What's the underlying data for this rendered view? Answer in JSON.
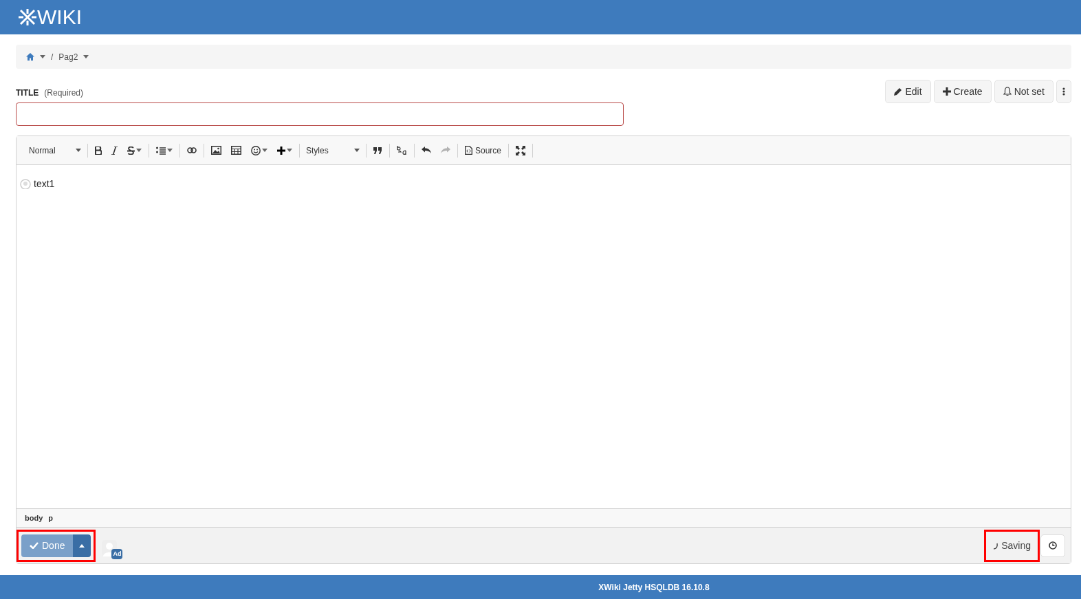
{
  "header": {
    "logo_text": "WIKI"
  },
  "breadcrumb": {
    "separator": "/",
    "items": [
      {
        "kind": "home"
      },
      {
        "kind": "page",
        "label": "Pag2"
      }
    ]
  },
  "title_field": {
    "label": "TITLE",
    "hint": "(Required)",
    "invalid": true
  },
  "page_actions": [
    {
      "kind": "edit",
      "label": "Edit"
    },
    {
      "kind": "create",
      "label": "Create"
    },
    {
      "kind": "notify",
      "label": "Not set"
    },
    {
      "kind": "more"
    }
  ],
  "toolbar": {
    "format": "Normal",
    "styles": "Styles",
    "source": "Source",
    "redo_disabled": true
  },
  "content": {
    "paragraphs": [
      "text1"
    ]
  },
  "path_bar": [
    "body",
    "p"
  ],
  "bottom_bar": {
    "done_label": "Done",
    "done_highlighted": true,
    "avatar_badge": "Ad",
    "saving_label": "Saving",
    "saving_highlighted": true
  },
  "footer": {
    "text": "XWiki Jetty HSQLDB 16.10.8"
  }
}
